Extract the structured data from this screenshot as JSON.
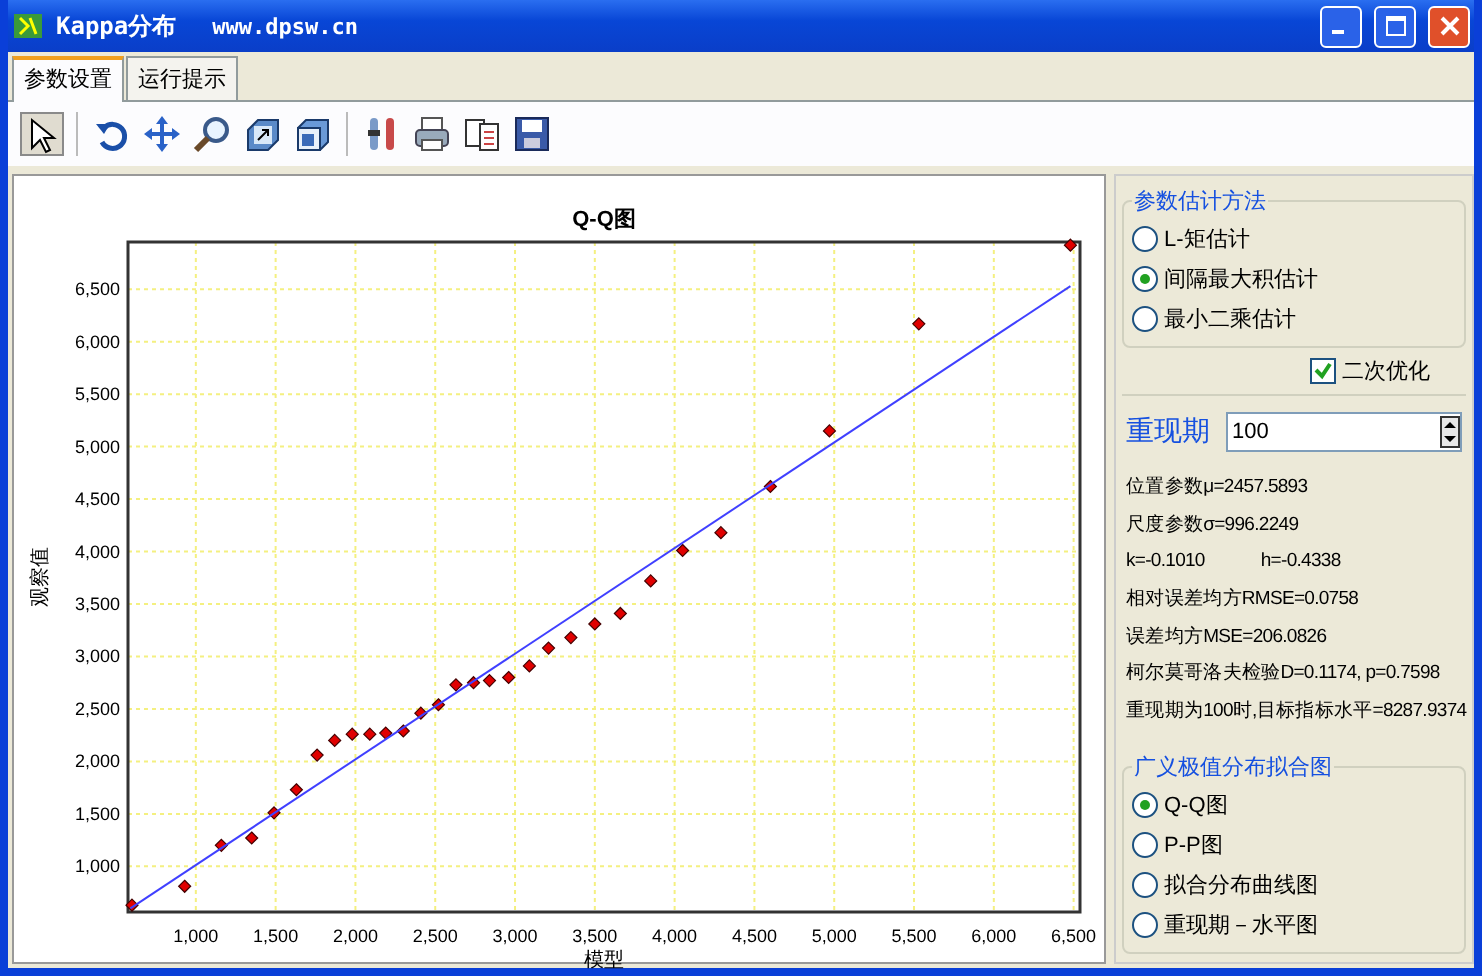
{
  "window": {
    "title": "Kappa分布",
    "url": "www.dpsw.cn"
  },
  "tabs": [
    {
      "label": "参数设置",
      "selected": true
    },
    {
      "label": "运行提示",
      "selected": false
    }
  ],
  "toolbar": [
    {
      "kind": "pointer",
      "selected": true
    },
    {
      "kind": "rotate",
      "selected": false
    },
    {
      "kind": "move",
      "selected": false
    },
    {
      "kind": "zoom",
      "selected": false
    },
    {
      "kind": "export",
      "selected": false
    },
    {
      "kind": "cube",
      "selected": false
    },
    {
      "kind": "tools",
      "selected": false
    },
    {
      "kind": "print",
      "selected": false
    },
    {
      "kind": "copy",
      "selected": false
    },
    {
      "kind": "save",
      "selected": false
    }
  ],
  "chart": {
    "chart_data": {
      "type": "scatter",
      "grid": true,
      "title": "Q-Q图",
      "xlabel": "模型",
      "ylabel": "观察值",
      "xlim": [
        575,
        6540
      ],
      "ylim": [
        565,
        6950
      ],
      "xticks": [
        {
          "value": 1000,
          "label": "1,000"
        },
        {
          "value": 1500,
          "label": "1,500"
        },
        {
          "value": 2000,
          "label": "2,000"
        },
        {
          "value": 2500,
          "label": "2,500"
        },
        {
          "value": 3000,
          "label": "3,000"
        },
        {
          "value": 3500,
          "label": "3,500"
        },
        {
          "value": 4000,
          "label": "4,000"
        },
        {
          "value": 4500,
          "label": "4,500"
        },
        {
          "value": 5000,
          "label": "5,000"
        },
        {
          "value": 5500,
          "label": "5,500"
        },
        {
          "value": 6000,
          "label": "6,000"
        },
        {
          "value": 6500,
          "label": "6,500"
        }
      ],
      "yticks": [
        {
          "value": 1000,
          "label": "1,000"
        },
        {
          "value": 1500,
          "label": "1,500"
        },
        {
          "value": 2000,
          "label": "2,000"
        },
        {
          "value": 2500,
          "label": "2,500"
        },
        {
          "value": 3000,
          "label": "3,000"
        },
        {
          "value": 3500,
          "label": "3,500"
        },
        {
          "value": 4000,
          "label": "4,000"
        },
        {
          "value": 4500,
          "label": "4,500"
        },
        {
          "value": 5000,
          "label": "5,000"
        },
        {
          "value": 5500,
          "label": "5,500"
        },
        {
          "value": 6000,
          "label": "6,000"
        },
        {
          "value": 6500,
          "label": "6,500"
        }
      ],
      "series": [
        {
          "type": "scatter",
          "color": "#e00000",
          "x": [
            600,
            930,
            1160,
            1350,
            1490,
            1630,
            1760,
            1870,
            1980,
            2090,
            2190,
            2300,
            2410,
            2520,
            2630,
            2740,
            2840,
            2960,
            3090,
            3210,
            3350,
            3500,
            3660,
            3850,
            4050,
            4290,
            4600,
            4970,
            5530,
            6480
          ],
          "values": [
            630,
            810,
            1200,
            1270,
            1510,
            1730,
            2060,
            2200,
            2260,
            2260,
            2270,
            2290,
            2460,
            2540,
            2730,
            2750,
            2770,
            2800,
            2910,
            3080,
            3180,
            3310,
            3410,
            3720,
            4010,
            4180,
            4620,
            5150,
            6170,
            6920
          ]
        },
        {
          "type": "line",
          "color": "#4040ff",
          "x": [
            590,
            6480
          ],
          "values": [
            600,
            6530
          ]
        }
      ]
    }
  },
  "method_group": {
    "title": "参数估计方法",
    "options": [
      {
        "label": "L-矩估计",
        "selected": false
      },
      {
        "label": "间隔最大积估计",
        "selected": true
      },
      {
        "label": "最小二乘估计",
        "selected": false
      }
    ]
  },
  "second_opt": {
    "label": "二次优化",
    "checked": true
  },
  "return_period": {
    "label": "重现期",
    "value": "100"
  },
  "results": [
    [
      "位置参数μ=2457.5893"
    ],
    [
      "尺度参数σ=996.2249"
    ],
    [
      "k=-0.1010",
      "h=-0.4338"
    ],
    [
      "相对误差均方RMSE=0.0758"
    ],
    [
      "误差均方MSE=206.0826"
    ],
    [
      "柯尔莫哥洛夫检验D=0.1174, p=0.7598"
    ],
    [
      "重现期为100时,目标指标水平=8287.9374"
    ]
  ],
  "plot_group": {
    "title": "广义极值分布拟合图",
    "options": [
      {
        "label": "Q-Q图",
        "selected": true
      },
      {
        "label": "P-P图",
        "selected": false
      },
      {
        "label": "拟合分布曲线图",
        "selected": false
      },
      {
        "label": "重现期－水平图",
        "selected": false
      }
    ]
  }
}
